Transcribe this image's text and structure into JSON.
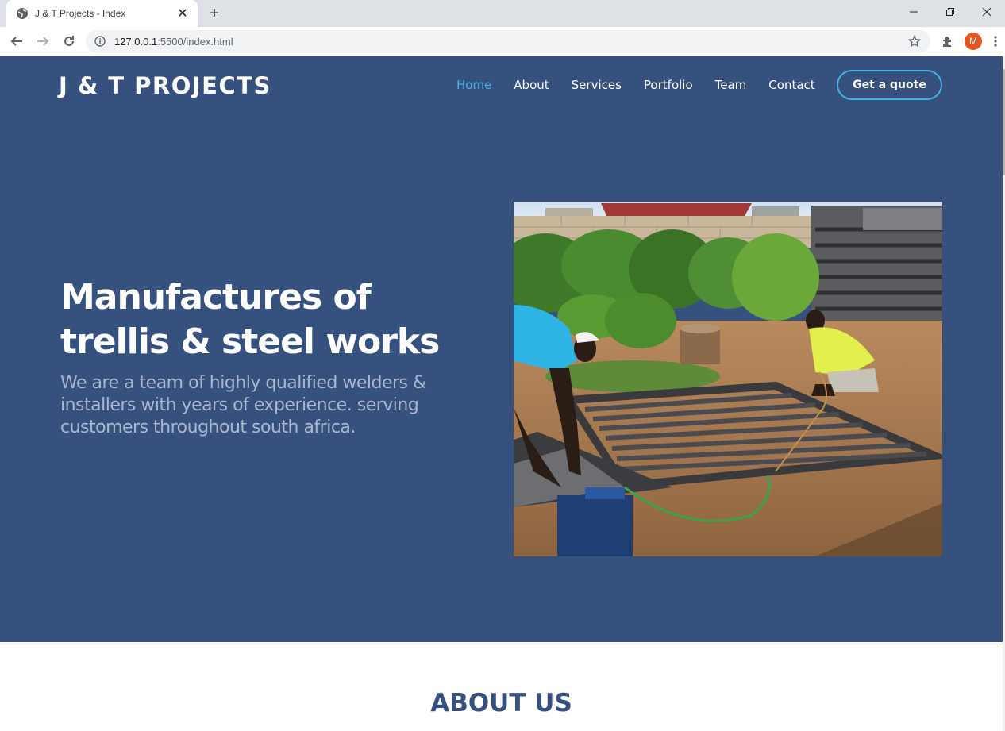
{
  "browser": {
    "tab_title": "J & T Projects - Index",
    "url_host": "127.0.0.1",
    "url_rest": ":5500/index.html",
    "profile_initial": "M",
    "accent_profile": "#e8541e"
  },
  "site": {
    "logo": "J & T PROJECTS",
    "nav": [
      "Home",
      "About",
      "Services",
      "Portfolio",
      "Team",
      "Contact"
    ],
    "active_nav": "Home",
    "cta": "Get a quote",
    "colors": {
      "hero_bg": "#37517e",
      "accent": "#47b2e4",
      "subtitle": "#a9b7cf"
    }
  },
  "hero": {
    "title": "Manufactures of trellis & steel works",
    "subtitle": "We are a team of highly qualified welders & installers with years of experience. serving customers throughout south africa."
  },
  "about": {
    "heading": "ABOUT US"
  }
}
